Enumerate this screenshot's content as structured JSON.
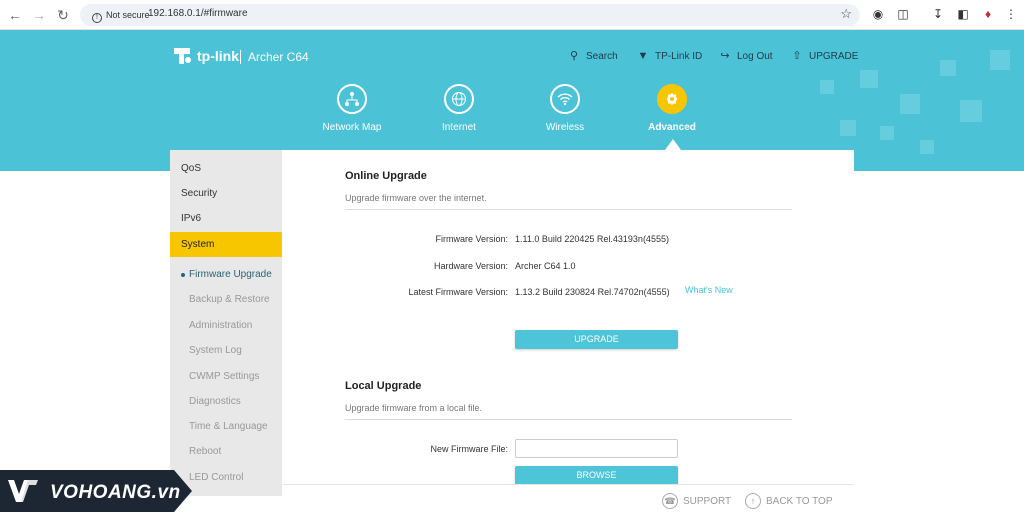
{
  "browser": {
    "security_label": "Not secure",
    "url": "192.168.0.1/#firmware"
  },
  "brand": {
    "logo_text": "tp-link",
    "model": "Archer C64"
  },
  "top_links": {
    "search": "Search",
    "tplink_id": "TP-Link ID",
    "logout": "Log Out",
    "upgrade": "UPGRADE"
  },
  "main_nav": [
    {
      "label": "Network Map",
      "icon": "network-map-icon"
    },
    {
      "label": "Internet",
      "icon": "globe-icon"
    },
    {
      "label": "Wireless",
      "icon": "wifi-icon"
    },
    {
      "label": "Advanced",
      "icon": "gear-icon",
      "active": true
    }
  ],
  "sidebar": {
    "items": [
      "QoS",
      "Security",
      "IPv6",
      "System"
    ],
    "active_item": "System",
    "sub_items": [
      "Firmware Upgrade",
      "Backup & Restore",
      "Administration",
      "System Log",
      "CWMP Settings",
      "Diagnostics",
      "Time & Language",
      "Reboot",
      "LED Control"
    ],
    "current_sub": "Firmware Upgrade"
  },
  "online_upgrade": {
    "title": "Online Upgrade",
    "description": "Upgrade firmware over the internet.",
    "firmware_version_label": "Firmware Version:",
    "firmware_version": "1.11.0 Build 220425 Rel.43193n(4555)",
    "hardware_version_label": "Hardware Version:",
    "hardware_version": "Archer C64 1.0",
    "latest_firmware_label": "Latest Firmware Version:",
    "latest_firmware": "1.13.2 Build 230824 Rel.74702n(4555)",
    "whats_new": "What's New",
    "upgrade_button": "UPGRADE"
  },
  "local_upgrade": {
    "title": "Local Upgrade",
    "description": "Upgrade firmware from a local file.",
    "new_file_label": "New Firmware File:",
    "file_value": "",
    "browse_button": "BROWSE"
  },
  "footer": {
    "support": "SUPPORT",
    "back_to_top": "BACK TO TOP"
  },
  "watermark": {
    "text": "VOHOANG.vn"
  },
  "colors": {
    "brand_teal": "#4cc2d6",
    "active_yellow": "#f7c600",
    "button_teal": "#4ec4d8"
  }
}
